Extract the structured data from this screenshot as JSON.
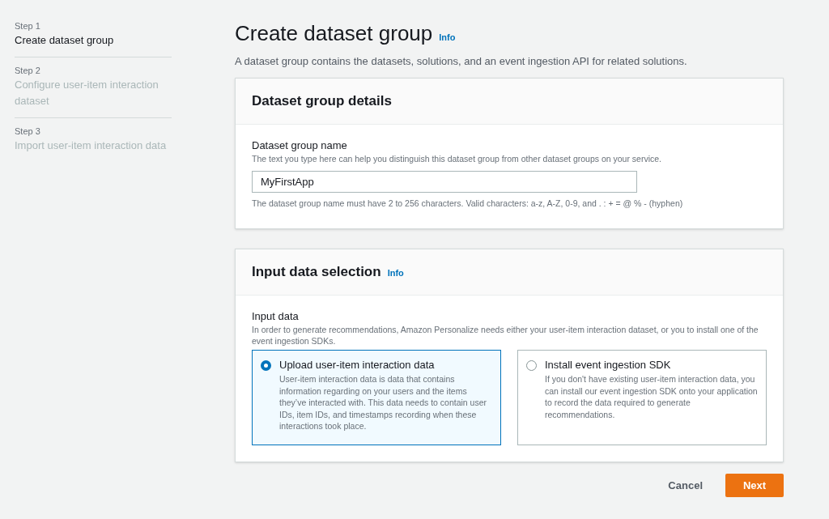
{
  "steps": [
    {
      "step": "Step 1",
      "title": "Create dataset group",
      "selected": true
    },
    {
      "step": "Step 2",
      "title": "Configure user-item interaction dataset",
      "selected": false
    },
    {
      "step": "Step 3",
      "title": "Import user-item interaction data",
      "selected": false
    }
  ],
  "page": {
    "title": "Create dataset group",
    "info": "Info",
    "description": "A dataset group contains the datasets, solutions, and an event ingestion API for related solutions."
  },
  "details_panel": {
    "title": "Dataset group details",
    "field": {
      "label": "Dataset group name",
      "description": "The text you type here can help you distinguish this dataset group from other dataset groups on your service.",
      "value": "MyFirstApp",
      "constraint": "The dataset group name must have 2 to 256 characters. Valid characters: a-z, A-Z, 0-9, and . : + = @ % - (hyphen)"
    }
  },
  "input_panel": {
    "title": "Input data selection",
    "info": "Info",
    "label": "Input data",
    "description": "In order to generate recommendations, Amazon Personalize needs either your user-item interaction dataset, or you to install one of the event ingestion SDKs.",
    "options": [
      {
        "title": "Upload user-item interaction data",
        "description": "User-item interaction data is data that contains information regarding on your users and the items they’ve interacted with. This data needs to contain user IDs, item IDs, and timestamps recording when these interactions took place.",
        "selected": true
      },
      {
        "title": "Install event ingestion SDK",
        "description": "If you don't have existing user-item interaction data, you can install our event ingestion SDK onto your application to record the data required to generate recommendations.",
        "selected": false
      }
    ]
  },
  "buttons": {
    "cancel": "Cancel",
    "next": "Next"
  }
}
